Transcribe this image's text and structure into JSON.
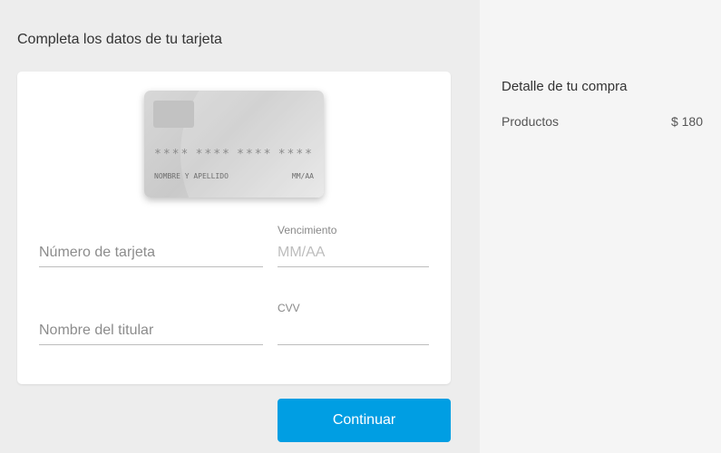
{
  "form": {
    "title": "Completa los datos de tu tarjeta",
    "card_preview": {
      "number_groups": [
        "****",
        "****",
        "****",
        "****"
      ],
      "holder_placeholder": "NOMBRE Y APELLIDO",
      "expiry_placeholder": "MM/AA"
    },
    "fields": {
      "card_number": {
        "label": "",
        "placeholder": "Número de tarjeta",
        "value": ""
      },
      "expiry": {
        "label": "Vencimiento",
        "placeholder": "MM/AA",
        "value": ""
      },
      "holder_name": {
        "label": "",
        "placeholder": "Nombre del titular",
        "value": ""
      },
      "cvv": {
        "label": "CVV",
        "placeholder": "",
        "value": ""
      }
    },
    "continue_label": "Continuar"
  },
  "summary": {
    "title": "Detalle de tu compra",
    "rows": [
      {
        "label": "Productos",
        "amount": "$ 180"
      }
    ]
  },
  "colors": {
    "button": "#009ee3",
    "left_bg": "#ededed",
    "right_bg": "#f5f5f5"
  }
}
